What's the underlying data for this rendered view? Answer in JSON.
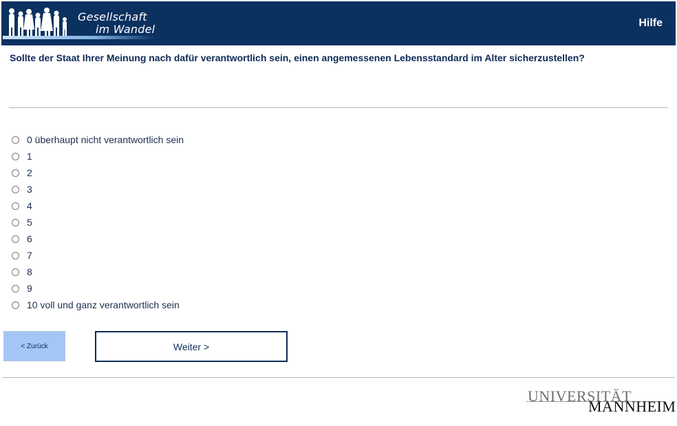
{
  "header": {
    "logo_line1": "Gesellschaft",
    "logo_line2": "im Wandel",
    "help_label": "Hilfe"
  },
  "question": {
    "text": "Sollte der Staat Ihrer Meinung nach dafür verantwortlich sein, einen angemessenen Lebensstandard im Alter sicherzustellen?"
  },
  "options": [
    "0 überhaupt nicht verantwortlich sein",
    "1",
    "2",
    "3",
    "4",
    "5",
    "6",
    "7",
    "8",
    "9",
    "10 voll und ganz verantwortlich sein"
  ],
  "navigation": {
    "back_label": "< Zurück",
    "next_label": "Weiter >"
  },
  "footer": {
    "uni_line1": "UNIVERSITÄT",
    "uni_line2": "MANNHEIM"
  },
  "colors": {
    "header_bg": "#0b3160",
    "back_button_bg": "#a4c6f7",
    "text": "#0d2a57"
  }
}
